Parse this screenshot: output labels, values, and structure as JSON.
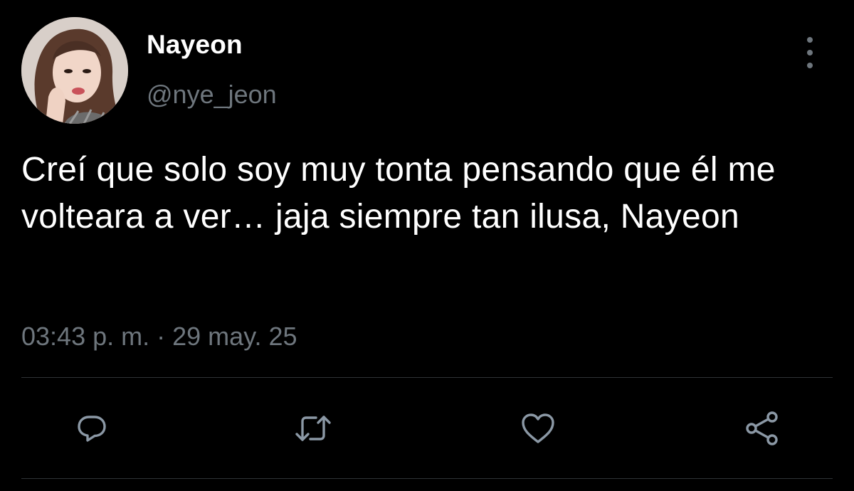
{
  "tweet": {
    "display_name": "Nayeon",
    "handle": "@nye_jeon",
    "text": "Creí que solo soy muy tonta pensando que él me volteara a ver… jaja siempre tan ilusa, Nayeon",
    "time": "03:43 p. m.",
    "separator": "·",
    "date": "29 may. 25"
  },
  "actions": {
    "reply": "reply-icon",
    "retweet": "retweet-icon",
    "like": "heart-icon",
    "share": "share-icon"
  },
  "colors": {
    "background": "#000000",
    "primary_text": "#ffffff",
    "secondary_text": "#6e767d",
    "icon": "#8b98a5",
    "divider": "#2f3336"
  }
}
